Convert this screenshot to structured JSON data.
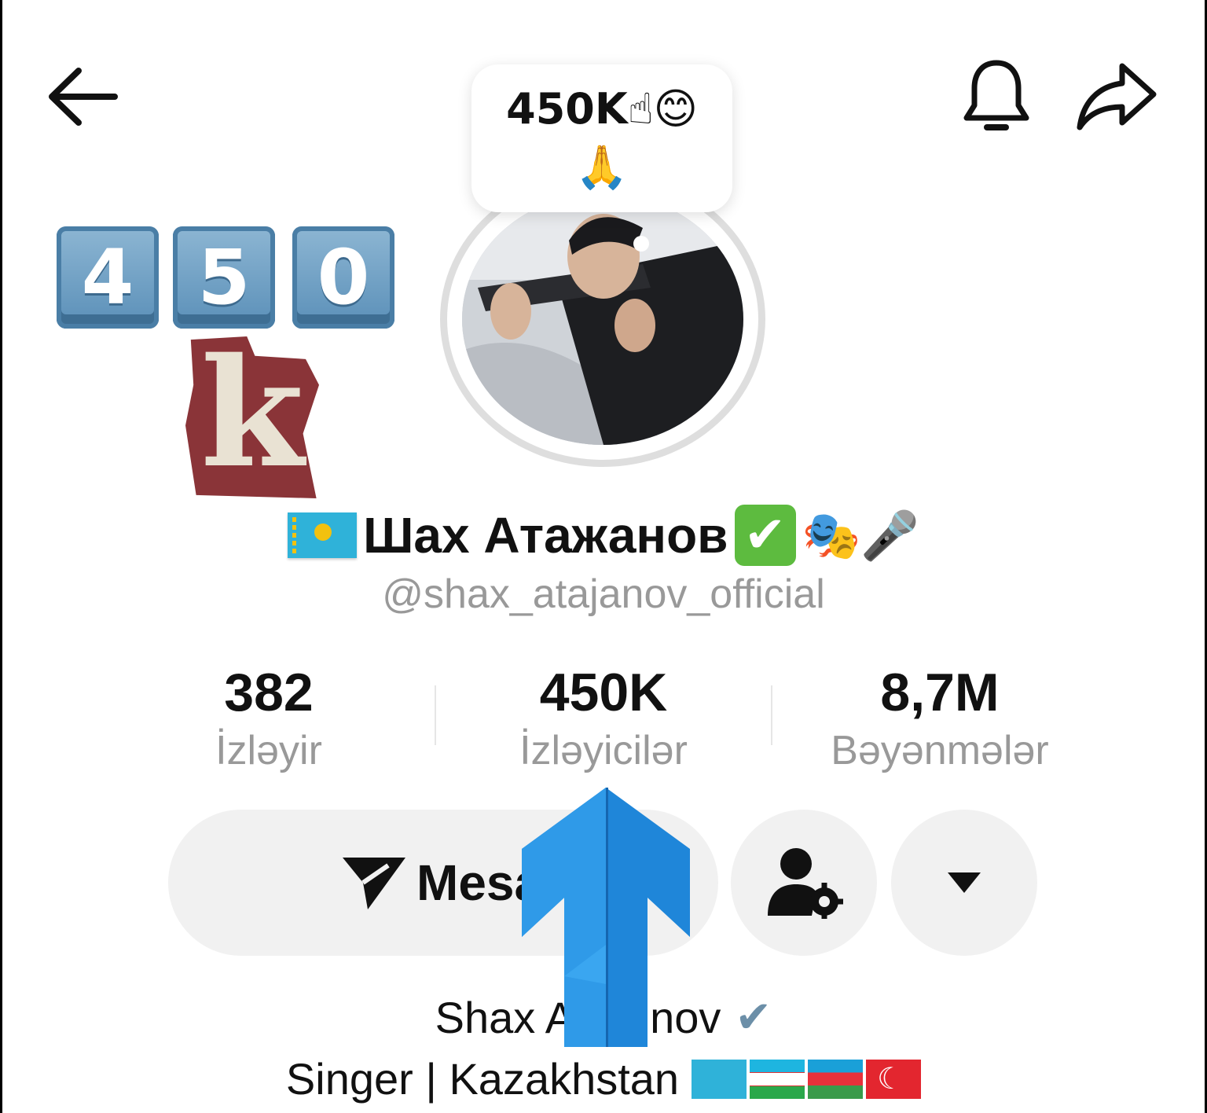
{
  "note": {
    "line1": "450K☝😊",
    "line2": "🙏"
  },
  "sticker": {
    "digits": [
      "4",
      "5",
      "0"
    ],
    "suffix": "k"
  },
  "profile": {
    "display_name": "Шах Атажанов",
    "name_emojis": "🎭🎤",
    "verified_mark": "✔",
    "handle": "@shax_atajanov_official"
  },
  "stats": [
    {
      "value": "382",
      "label": "İzləyir"
    },
    {
      "value": "450K",
      "label": "İzləyicilər"
    },
    {
      "value": "8,7M",
      "label": "Bəyənmələr"
    }
  ],
  "actions": {
    "message_label": "Mesa"
  },
  "bio": {
    "line1_a": "Shax A",
    "line1_b": "nov",
    "line1_mark": "✔",
    "line2": "Singer | Kazakhstan"
  },
  "icons": {
    "back": "arrow-left-icon",
    "bell": "bell-icon",
    "share": "share-arrow-icon",
    "send": "send-icon",
    "profile_settings": "user-gear-icon",
    "more": "caret-down-icon",
    "overlay_arrow": "up-arrow-icon"
  },
  "colors": {
    "accent_blue": "#2b8fe0",
    "muted_text": "#999999",
    "button_bg": "#f1f1f1"
  }
}
